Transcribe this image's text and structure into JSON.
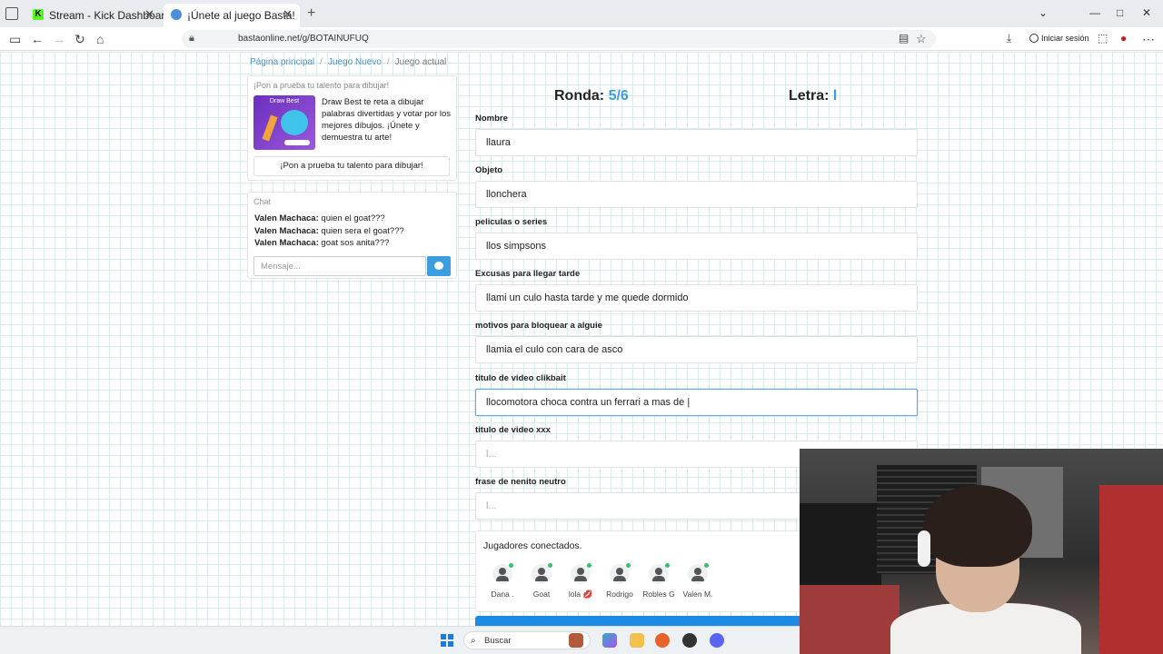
{
  "browser": {
    "tabs": [
      {
        "label": "Stream - Kick Dashboard",
        "favicon": "K"
      },
      {
        "label": "¡Únete al juego Basta!"
      }
    ],
    "url": "bastaonline.net/g/BOTAINUFUQ",
    "login_label": "Iniciar sesión"
  },
  "breadcrumb": {
    "home": "Página principal",
    "new": "Juego Nuevo",
    "current": "Juego actual"
  },
  "promo": {
    "heading": "¡Pon a prueba tu talento para dibujar!",
    "image_logo": "Draw Best",
    "text": "Draw Best te reta a dibujar palabras divertidas y votar por los mejores dibujos. ¡Únete y demuestra tu arte!",
    "button": "¡Pon a prueba tu talento para dibujar!"
  },
  "chat": {
    "heading": "Chat",
    "messages": [
      {
        "user": "Valen Machaca:",
        "text": "quien el goat???"
      },
      {
        "user": "Valen Machaca:",
        "text": "quien sera el goat???"
      },
      {
        "user": "Valen Machaca:",
        "text": "goat sos anita???"
      }
    ],
    "placeholder": "Mensaje..."
  },
  "game": {
    "round_label": "Ronda:",
    "round_value": "5/6",
    "letter_label": "Letra:",
    "letter_value": "l",
    "fields": [
      {
        "label": "Nombre",
        "value": "llaura"
      },
      {
        "label": "Objeto",
        "value": "llonchera"
      },
      {
        "label": "peliculas o series",
        "value": "llos simpsons"
      },
      {
        "label": "Excusas para llegar tarde",
        "value": "llami un culo hasta tarde y me quede dormido"
      },
      {
        "label": "motivos para bloquear a alguie",
        "value": "llamia el culo con cara de asco"
      },
      {
        "label": "titulo de video clikbait",
        "value": "llocomotora choca contra un ferrari a mas de |"
      },
      {
        "label": "titulo de video xxx",
        "value": "l..."
      },
      {
        "label": "frase de nenito neutro",
        "value": "l..."
      }
    ],
    "players_title": "Jugadores conectados.",
    "players": [
      "Dana .",
      "Goat",
      "lola 💋",
      "Rodrigo",
      "Robles G",
      "Valen M."
    ]
  },
  "taskbar": {
    "search": "Buscar"
  },
  "colors": {
    "accent": "#3a9ee0",
    "grid": "#d9ecea",
    "online": "#33c46a"
  }
}
